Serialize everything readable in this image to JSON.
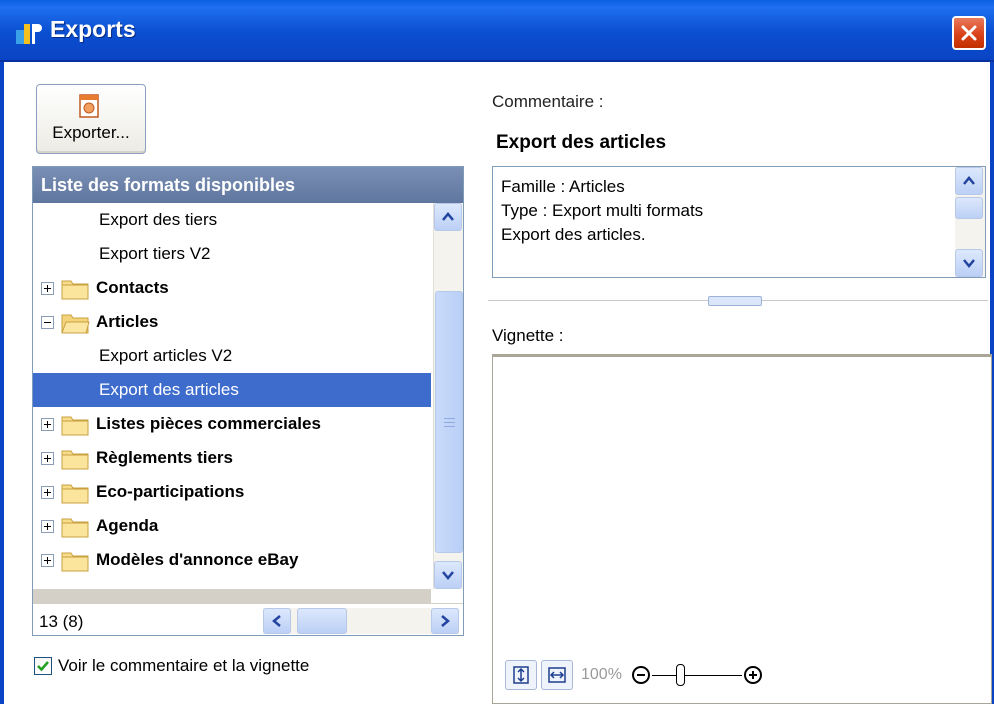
{
  "window": {
    "title": "Exports",
    "app_icon": "pohl-logo-icon",
    "close_icon": "close-icon"
  },
  "toolbar": {
    "export_label": "Exporter...",
    "export_icon": "document-export-icon"
  },
  "list": {
    "header": "Liste des formats disponibles",
    "items": [
      {
        "label": "Export des tiers",
        "type": "child"
      },
      {
        "label": "Export tiers V2",
        "type": "child"
      },
      {
        "label": "Contacts",
        "type": "group",
        "expanded": false
      },
      {
        "label": "Articles",
        "type": "group",
        "expanded": true
      },
      {
        "label": "Export articles V2",
        "type": "child"
      },
      {
        "label": "Export des articles",
        "type": "child",
        "selected": true
      },
      {
        "label": "Listes pièces commerciales",
        "type": "group",
        "expanded": false
      },
      {
        "label": "Règlements tiers",
        "type": "group",
        "expanded": false
      },
      {
        "label": "Eco-participations",
        "type": "group",
        "expanded": false
      },
      {
        "label": "Agenda",
        "type": "group",
        "expanded": false
      },
      {
        "label": "Modèles d'annonce eBay",
        "type": "group",
        "expanded": false
      }
    ],
    "status_count": "13 (8)"
  },
  "options": {
    "show_comment_label": "Voir le commentaire et la vignette",
    "show_comment_checked": true
  },
  "comment": {
    "label": "Commentaire :",
    "title": "Export des articles",
    "text": "Famille : Articles\nType : Export multi formats\nExport des articles."
  },
  "vignette": {
    "label": "Vignette :",
    "zoom": "100%"
  },
  "colors": {
    "titlebar": "#0a4ed0",
    "selection": "#3d6ccc",
    "list_header": "#6b81a8",
    "close": "#d9421a"
  }
}
